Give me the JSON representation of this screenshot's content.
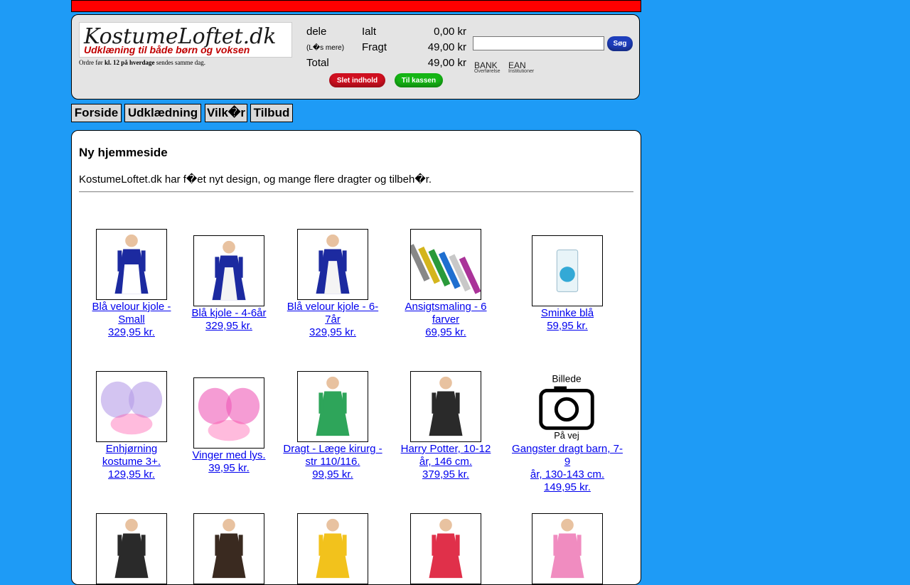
{
  "header": {
    "logo_title": "KostumeLoftet.dk",
    "logo_subtitle": "Udklæning til både børn og voksen",
    "order_note_pre": "Ordre før ",
    "order_note_bold": "kl. 12 på hverdage",
    "order_note_post": " sendes samme dag."
  },
  "cart": {
    "rows": [
      {
        "c1": "dele",
        "c2": "Ialt",
        "c3": "0,00 kr"
      },
      {
        "c1": "(L�s mere)",
        "c2": "Fragt",
        "c3": "49,00 kr"
      },
      {
        "c1": "Total",
        "c2": "",
        "c3": "49,00 kr"
      }
    ],
    "clear_label": "Slet indhold",
    "checkout_label": "Til kassen"
  },
  "search": {
    "placeholder": "",
    "button_label": "Søg"
  },
  "payment": {
    "bank": "BANK",
    "bank_sub": "Overførelse",
    "ean": "EAN",
    "ean_sub": "Institutioner"
  },
  "nav": [
    {
      "label": "Forside"
    },
    {
      "label": "Udklædning"
    },
    {
      "label": "Vilk�r"
    },
    {
      "label": "Tilbud"
    }
  ],
  "main": {
    "title": "Ny hjemmeside",
    "intro": "KostumeLoftet.dk har f�et nyt design, og mange flere dragter og tilbeh�r."
  },
  "products": [
    {
      "l1": "Blå velour kjole -",
      "l2": "Small",
      "price": "329,95 kr.",
      "icon": "blue-dress-pair-icon",
      "color": "#1c2aa0"
    },
    {
      "l1": "Blå kjole - 4-6år",
      "l2": "",
      "price": "329,95 kr.",
      "icon": "blue-dress-icon",
      "color": "#1c2aa0"
    },
    {
      "l1": "Blå velour kjole - 6-",
      "l2": "7år",
      "price": "329,95 kr.",
      "icon": "blue-dress-icon",
      "color": "#1c2aa0"
    },
    {
      "l1": "Ansigtsmaling - 6",
      "l2": "farver",
      "price": "69,95 kr.",
      "icon": "glitter-tubes-icon",
      "color": "#444444"
    },
    {
      "l1": "Sminke blå",
      "l2": "",
      "price": "59,95 kr.",
      "icon": "makeup-pack-icon",
      "color": "#33a9d6"
    },
    {
      "l1": "Enhjørning",
      "l2": "kostume 3+.",
      "price": "129,95 kr.",
      "icon": "unicorn-wings-icon",
      "color": "#b69ce8"
    },
    {
      "l1": "Vinger med lys.",
      "l2": "",
      "price": "39,95 kr.",
      "icon": "pink-wings-icon",
      "color": "#ee5ab8"
    },
    {
      "l1": "Dragt - Læge kirurg -",
      "l2": "str 110/116.",
      "price": "99,95 kr.",
      "icon": "surgeon-costume-icon",
      "color": "#2ea55a"
    },
    {
      "l1": "Harry Potter, 10-12",
      "l2": "år, 146 cm.",
      "price": "379,95 kr.",
      "icon": "wizard-robe-icon",
      "color": "#2a2a2a"
    },
    {
      "l1": "Gangster dragt barn, 7-9",
      "l2": "år, 130-143 cm.",
      "price": "149,95 kr.",
      "icon": "camera-placeholder-icon",
      "color": "#000000"
    },
    {
      "l1": "",
      "l2": "",
      "price": "",
      "icon": "wizard-robe-icon",
      "color": "#2a2a2a"
    },
    {
      "l1": "",
      "l2": "",
      "price": "",
      "icon": "monkey-costume-icon",
      "color": "#3a2a20"
    },
    {
      "l1": "",
      "l2": "",
      "price": "",
      "icon": "chick-costume-icon",
      "color": "#f2c21c"
    },
    {
      "l1": "",
      "l2": "",
      "price": "",
      "icon": "pig-costume-icon",
      "color": "#e0304a"
    },
    {
      "l1": "",
      "l2": "",
      "price": "",
      "icon": "pink-dress-icon",
      "color": "#f08cc0"
    }
  ],
  "placeholder_image": {
    "line1": "Billede",
    "line2": "På vej"
  }
}
